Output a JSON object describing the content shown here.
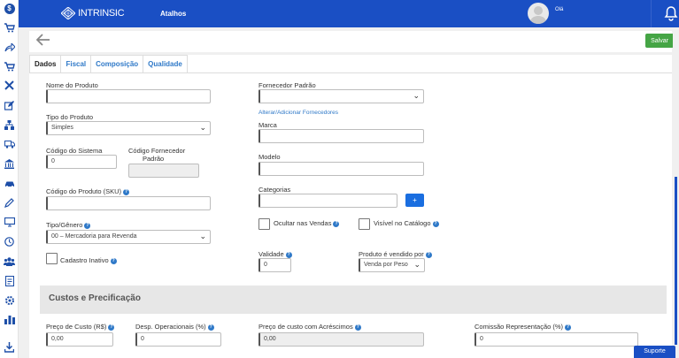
{
  "brand": {
    "logo_text": "INTRINSIC",
    "atalhos": "Atalhos",
    "greeting": "Olá"
  },
  "sidebar": {
    "icons": [
      "dollar-icon",
      "cart-icon",
      "share-icon",
      "cart-icon",
      "tools-icon",
      "edit-icon",
      "sitemap-icon",
      "truck-icon",
      "bank-icon",
      "car-icon",
      "pen-icon",
      "monitor-icon",
      "clock-icon",
      "users-icon",
      "report-icon",
      "gear-icon",
      "chart-icon",
      "download-icon"
    ],
    "glyphs": [
      "$",
      "🛒",
      "➦",
      "🛒",
      "✕",
      "✎",
      "▦",
      "⛟",
      "⌂",
      "▬",
      "✎",
      "▭",
      "◷",
      "●●",
      "▤",
      "⚙",
      "▮",
      "⤓"
    ]
  },
  "actions": {
    "save_label": "Salvar"
  },
  "tabs": [
    {
      "label": "Dados",
      "active": true
    },
    {
      "label": "Fiscal",
      "active": false
    },
    {
      "label": "Composição",
      "active": false
    },
    {
      "label": "Qualidade",
      "active": false
    }
  ],
  "form": {
    "nome_produto": {
      "label": "Nome do Produto",
      "value": ""
    },
    "tipo_produto": {
      "label": "Tipo do Produto",
      "value": "Simples"
    },
    "codigo_sistema": {
      "label": "Código do Sistema",
      "value": "0"
    },
    "codigo_fornecedor": {
      "label_line1": "Código Fornecedor",
      "label_line2": "Padrão",
      "value": ""
    },
    "codigo_sku": {
      "label": "Código do Produto (SKU)",
      "value": ""
    },
    "tipo_genero": {
      "label": "Tipo/Gênero",
      "value": "00 – Mercadoria para Revenda"
    },
    "cadastro_inativo": {
      "label": "Cadastro Inativo"
    },
    "fornecedor_padrao": {
      "label": "Fornecedor Padrão",
      "value": ""
    },
    "alterar_fornecedores": "Alterar/Adicionar Fornecedores",
    "marca": {
      "label": "Marca",
      "value": ""
    },
    "modelo": {
      "label": "Modelo",
      "value": ""
    },
    "categorias": {
      "label": "Categorias",
      "value": "",
      "add_label": "+"
    },
    "ocultar_vendas": {
      "label": "Ocultar nas Vendas"
    },
    "visivel_catalogo": {
      "label": "Visível no Catálogo"
    },
    "validade": {
      "label": "Validade",
      "value": "0"
    },
    "vendido_por": {
      "label": "Produto é vendido por",
      "value": "Venda por Peso"
    }
  },
  "custos": {
    "title": "Custos e Precificação",
    "preco_custo": {
      "label": "Preço de Custo (R$)",
      "value": "0,00"
    },
    "desp_operacionais": {
      "label": "Desp. Operacionais (%)",
      "value": "0"
    },
    "preco_acrescimos": {
      "label": "Preço de custo com Acréscimos",
      "value": "0,00"
    },
    "comissao": {
      "label": "Comissão Representação (%)",
      "value": "0"
    }
  },
  "support": {
    "label": "Suporte"
  },
  "colors": {
    "primary": "#1a4fc4",
    "save": "#45a545",
    "link": "#2f79c8"
  }
}
